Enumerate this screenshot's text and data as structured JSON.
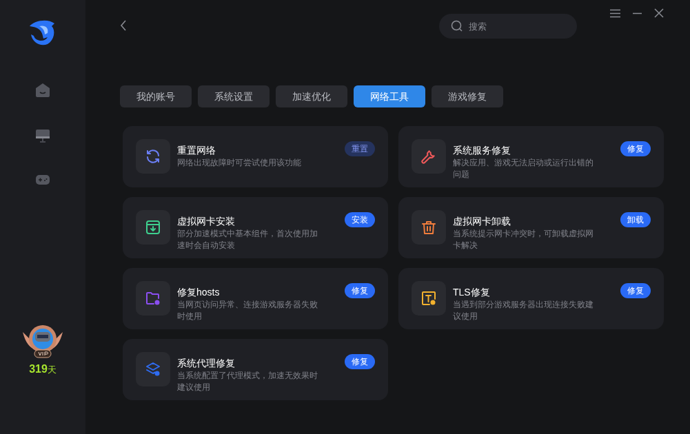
{
  "search": {
    "placeholder": "搜索"
  },
  "tabs": [
    {
      "label": "我的账号",
      "selected": false
    },
    {
      "label": "系统设置",
      "selected": false
    },
    {
      "label": "加速优化",
      "selected": false
    },
    {
      "label": "网络工具",
      "selected": true
    },
    {
      "label": "游戏修复",
      "selected": false
    }
  ],
  "tools": [
    {
      "kind": "refresh",
      "title": "重置网络",
      "description": "网络出现故障时可尝试使用该功能",
      "button": "重置",
      "button_muted": true
    },
    {
      "kind": "wrench",
      "title": "系统服务修复",
      "description": "解决应用、游戏无法启动或运行出错的问题",
      "button": "修复",
      "button_muted": false
    },
    {
      "kind": "download",
      "title": "虚拟网卡安装",
      "description": "部分加速模式中基本组件，首次使用加速时会自动安装",
      "button": "安装",
      "button_muted": false
    },
    {
      "kind": "trash",
      "title": "虚拟网卡卸载",
      "description": "当系统提示网卡冲突时，可卸载虚拟网卡解决",
      "button": "卸载",
      "button_muted": false
    },
    {
      "kind": "folder",
      "title": "修复hosts",
      "description": "当网页访问异常、连接游戏服务器失败时使用",
      "button": "修复",
      "button_muted": false
    },
    {
      "kind": "tls",
      "title": "TLS修复",
      "description": "当遇到部分游戏服务器出现连接失败建议使用",
      "button": "修复",
      "button_muted": false
    },
    {
      "kind": "proxy",
      "title": "系统代理修复",
      "description": "当系统配置了代理模式，加速无效果时建议使用",
      "button": "修复",
      "button_muted": false
    }
  ],
  "vip": {
    "days": "319",
    "unit": "天"
  }
}
